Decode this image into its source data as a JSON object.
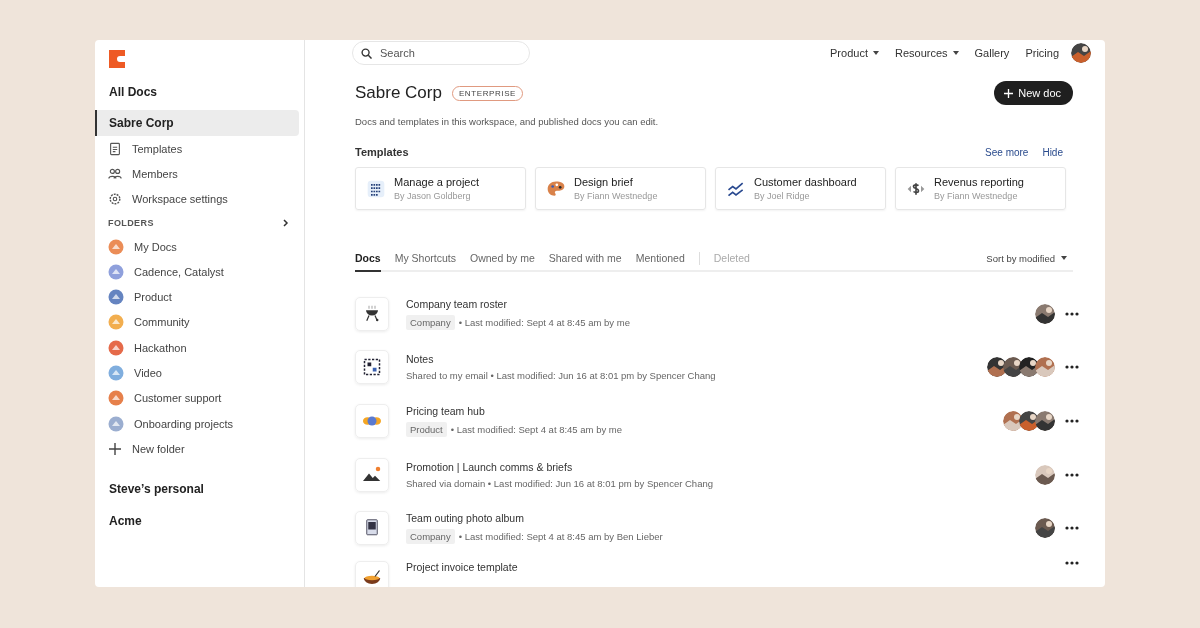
{
  "sidebar": {
    "title": "All Docs",
    "workspaces": [
      {
        "name": "Sabre Corp",
        "selected": true,
        "nav": [
          {
            "label": "Templates"
          },
          {
            "label": "Members"
          },
          {
            "label": "Workspace settings"
          }
        ],
        "folders_label": "FOLDERS",
        "folders": [
          {
            "name": "My Docs"
          },
          {
            "name": "Cadence, Catalyst"
          },
          {
            "name": "Product"
          },
          {
            "name": "Community"
          },
          {
            "name": "Hackathon"
          },
          {
            "name": "Video"
          },
          {
            "name": "Customer support"
          },
          {
            "name": "Onboarding projects"
          }
        ],
        "new_folder": "New folder"
      },
      {
        "name": "Steve’s personal",
        "selected": false
      },
      {
        "name": "Acme",
        "selected": false
      }
    ]
  },
  "topbar": {
    "search": {
      "placeholder": "Search"
    },
    "menus": [
      {
        "label": "Product",
        "dropdown": true
      },
      {
        "label": "Resources",
        "dropdown": true
      },
      {
        "label": "Gallery",
        "dropdown": false
      },
      {
        "label": "Pricing",
        "dropdown": false
      }
    ]
  },
  "header": {
    "title": "Sabre Corp",
    "badge": "ENTERPRISE",
    "new_button": "New doc",
    "description": "Docs and templates in this workspace, and published docs you can edit."
  },
  "templates": {
    "title": "Templates",
    "see_more": "See more",
    "hide": "Hide",
    "items": [
      {
        "name": "Manage a project",
        "author": "By Jason Goldberg"
      },
      {
        "name": "Design brief",
        "author": "By Fiann Westnedge"
      },
      {
        "name": "Customer dashboard",
        "author": "By Joel Ridge"
      },
      {
        "name": "Revenus reporting",
        "author": "By Fiann Westnedge"
      }
    ]
  },
  "tabs": [
    {
      "label": "Docs",
      "selected": true,
      "disabled": false
    },
    {
      "label": "My Shortcuts",
      "selected": false,
      "disabled": false
    },
    {
      "label": "Owned by me",
      "selected": false,
      "disabled": false
    },
    {
      "label": "Shared with me",
      "selected": false,
      "disabled": false
    },
    {
      "label": "Mentioned",
      "selected": false,
      "disabled": false
    },
    {
      "label": "Deleted",
      "selected": false,
      "disabled": true
    }
  ],
  "sort": "Sort by modified",
  "docs": [
    {
      "title": "Company team roster",
      "tag": "Company",
      "meta": "• Last modified: Sept 4 at 8:45 am by me"
    },
    {
      "title": "Notes",
      "meta": "Shared to my email • Last modified: Jun 16 at 8:01 pm by Spencer Chang"
    },
    {
      "title": "Pricing team hub",
      "tag": "Product",
      "meta": "• Last modified: Sept 4 at 8:45 am by me"
    },
    {
      "title": "Promotion | Launch comms & briefs",
      "meta": "Shared via domain • Last modified: Jun 16 at 8:01 pm by Spencer Chang"
    },
    {
      "title": "Team outing photo album",
      "tag": "Company",
      "meta": "• Last modified: Sept 4 at 8:45 am by Ben Lieber"
    },
    {
      "title": "Project invoice template"
    }
  ]
}
